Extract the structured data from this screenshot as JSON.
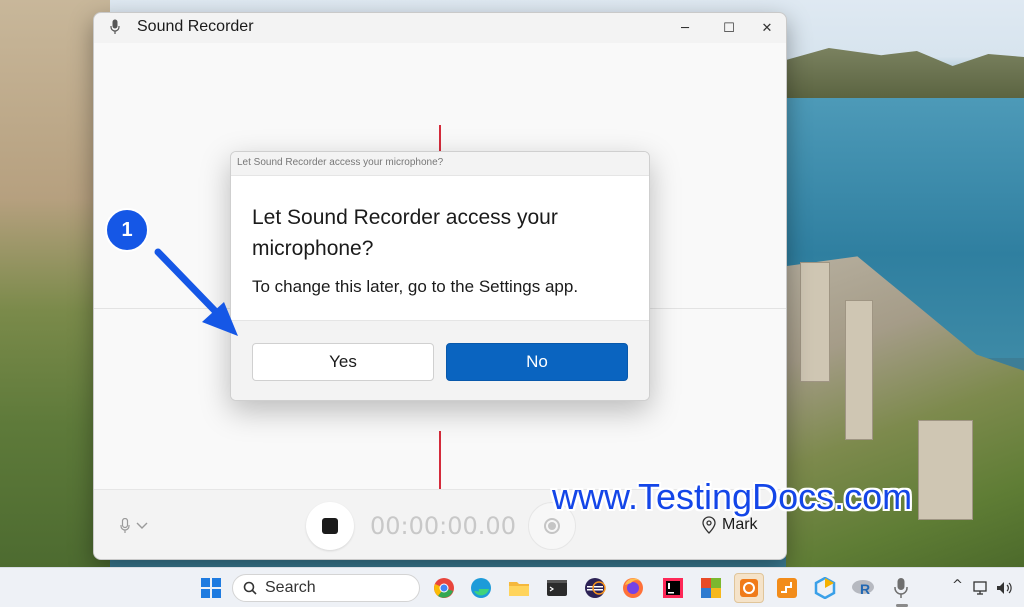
{
  "window": {
    "title": "Sound Recorder",
    "controls": {
      "minimize": "─",
      "maximize": "☐",
      "close": "✕"
    }
  },
  "recorder": {
    "timer": "00:00:00.00",
    "mark_label": "Mark"
  },
  "dialog": {
    "caption": "Let Sound Recorder access your microphone?",
    "heading": "Let Sound Recorder access your microphone?",
    "description": "To change this later, go to the Settings app.",
    "yes_label": "Yes",
    "no_label": "No"
  },
  "annotation": {
    "step": "1"
  },
  "watermark": "www.TestingDocs.com",
  "taskbar": {
    "search_label": "Search",
    "apps": [
      "chrome-icon",
      "edge-icon",
      "file-explorer-icon",
      "terminal-icon",
      "eclipse-icon",
      "firefox-icon",
      "intellij-icon",
      "office-icon",
      "app-orange-icon",
      "app-orange2-icon",
      "app-hex-icon",
      "r-icon",
      "sound-recorder-taskbar-icon"
    ],
    "tray_chevron": "^"
  },
  "colors": {
    "accent": "#0a64c0",
    "playhead": "#d42b3b",
    "badge": "#1557e6"
  }
}
